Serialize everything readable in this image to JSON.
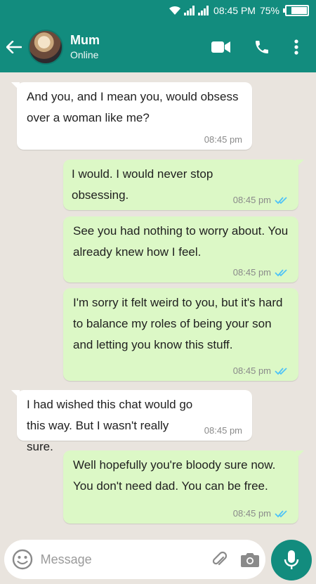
{
  "status_bar": {
    "time": "08:45 PM",
    "battery": "75%"
  },
  "header": {
    "contact_name": "Mum",
    "presence": "Online"
  },
  "messages": [
    {
      "direction": "in",
      "text": "And you, and I mean you, would obsess over a woman like me?",
      "time": "08:45 pm"
    },
    {
      "direction": "out",
      "text": "I would. I would never stop obsessing.",
      "time": "08:45 pm"
    },
    {
      "direction": "out",
      "text": "See you had nothing to worry about. You already knew how I feel.",
      "time": "08:45 pm"
    },
    {
      "direction": "out",
      "text": "I'm sorry it felt weird to you, but it's hard to balance my roles of being your son and letting you know this stuff.",
      "time": "08:45 pm"
    },
    {
      "direction": "in",
      "text": "I had wished this chat would go this way. But I wasn't really sure.",
      "time": "08:45 pm"
    },
    {
      "direction": "out",
      "text": "Well hopefully you're bloody sure now. You don't need dad. You can be free.",
      "time": "08:45 pm"
    }
  ],
  "composer": {
    "placeholder": "Message"
  },
  "colors": {
    "primary": "#128c7e",
    "incoming_bubble": "#ffffff",
    "outgoing_bubble": "#dcf8c6",
    "read_ticks": "#4fc3f7"
  },
  "icons": [
    "wifi-icon",
    "signal-icon",
    "battery-icon",
    "back-arrow-icon",
    "video-call-icon",
    "phone-icon",
    "more-vert-icon",
    "emoji-icon",
    "attach-icon",
    "camera-icon",
    "mic-icon",
    "double-check-icon"
  ]
}
